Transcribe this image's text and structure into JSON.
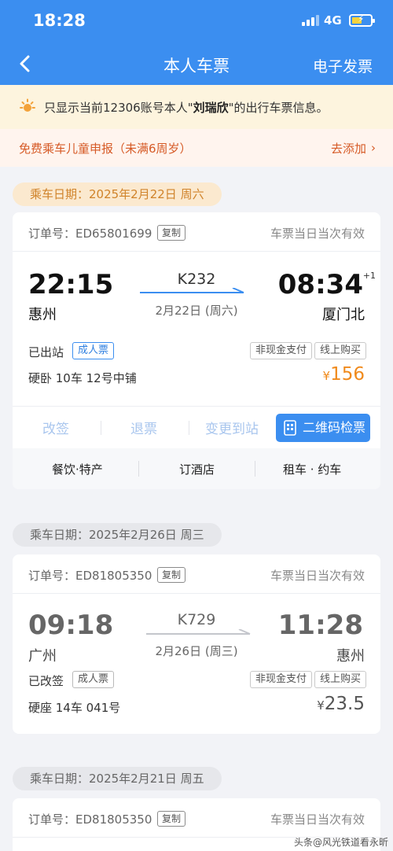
{
  "status_bar": {
    "time": "18:28",
    "network": "4G"
  },
  "nav": {
    "title": "本人车票",
    "right": "电子发票"
  },
  "notice": {
    "prefix": "只显示当前12306账号本人\"",
    "name": "刘瑞欣",
    "suffix": "\"的出行车票信息。"
  },
  "child": {
    "text": "免费乘车儿童申报（未满6周岁）",
    "link": "去添加"
  },
  "tickets": [
    {
      "date": "乘车日期：2025年2月22日 周六",
      "order_label": "订单号：ED65801699",
      "copy": "复制",
      "valid": "车票当日当次有效",
      "dep_time": "22:15",
      "dep_station": "惠州",
      "train_no": "K232",
      "train_date": "2月22日 (周六)",
      "arr_time": "08:34",
      "arr_plus": "+1",
      "arr_station": "厦门北",
      "status": "已出站",
      "passenger_type": "成人票",
      "pay_tags": [
        "非现金支付",
        "线上购买"
      ],
      "seat": "硬卧 10车 12号中铺",
      "price_symbol": "¥",
      "price": "156",
      "actions": [
        "改签",
        "退票",
        "变更到站"
      ],
      "qr_button": "二维码检票",
      "services": [
        "餐饮·特产",
        "订酒店",
        "租车 · 约车"
      ]
    },
    {
      "date": "乘车日期：2025年2月26日 周三",
      "order_label": "订单号：ED81805350",
      "copy": "复制",
      "valid": "车票当日当次有效",
      "dep_time": "09:18",
      "dep_station": "广州",
      "train_no": "K729",
      "train_date": "2月26日 (周三)",
      "arr_time": "11:28",
      "arr_station": "惠州",
      "status": "已改签",
      "passenger_type": "成人票",
      "pay_tags": [
        "非现金支付",
        "线上购买"
      ],
      "seat": "硬座 14车 041号",
      "price_symbol": "¥",
      "price": "23.5"
    },
    {
      "date": "乘车日期：2025年2月21日 周五",
      "order_label": "订单号：ED81805350",
      "copy": "复制",
      "valid": "车票当日当次有效"
    }
  ],
  "watermark": "头条@风光铁道看永昕",
  "colors": {
    "primary_blue": "#3b8ef0",
    "price_orange": "#f08a1c",
    "child_orange": "#d65a26"
  }
}
